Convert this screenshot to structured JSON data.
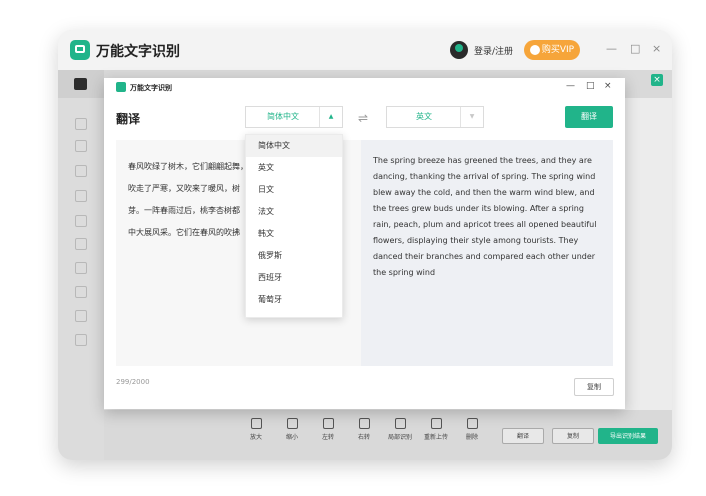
{
  "app": {
    "title": "万能文字识别",
    "login_label": "登录/注册",
    "vip_label": "购买VIP",
    "min_symbol": "—",
    "max_symbol": "□",
    "close_symbol": "×",
    "tab_close_symbol": "×"
  },
  "footer": {
    "tools": [
      "放大",
      "缩小",
      "左转",
      "右转",
      "局部识别",
      "重新上传",
      "删除"
    ],
    "buttons": {
      "translate": "翻译",
      "copy": "复制",
      "export": "导出识别结果"
    }
  },
  "dialog": {
    "app_name": "万能文字识别",
    "min_symbol": "—",
    "max_symbol": "□",
    "close_symbol": "×",
    "heading": "翻译",
    "source_lang": "简体中文",
    "source_arrow": "▲",
    "swap_symbol": "⇌",
    "target_lang": "英文",
    "target_arrow": "▼",
    "translate_button": "翻译",
    "source_text": "春风吹绿了树木，它们翩翩起舞，\n吹走了严寒，又吹来了暖风，树\n芽。一阵春雨过后，桃李杏树都\n中大展风采。它们在春风的吹拂",
    "target_text": "The spring breeze has greened the trees, and they are dancing, thanking the arrival of spring. The spring wind blew away the cold, and then the warm wind blew, and the trees grew buds under its blowing. After a spring rain, peach, plum and apricot trees all opened beautiful flowers, displaying their style among tourists. They danced their branches and compared each other under the spring wind",
    "char_count": "299/2000",
    "copy_button": "复制",
    "dropdown_options": [
      "简体中文",
      "英文",
      "日文",
      "法文",
      "韩文",
      "俄罗斯",
      "西班牙",
      "葡萄牙"
    ],
    "dropdown_selected": "简体中文"
  },
  "colors": {
    "accent": "#21b48a",
    "vip": "#f6a53a"
  }
}
